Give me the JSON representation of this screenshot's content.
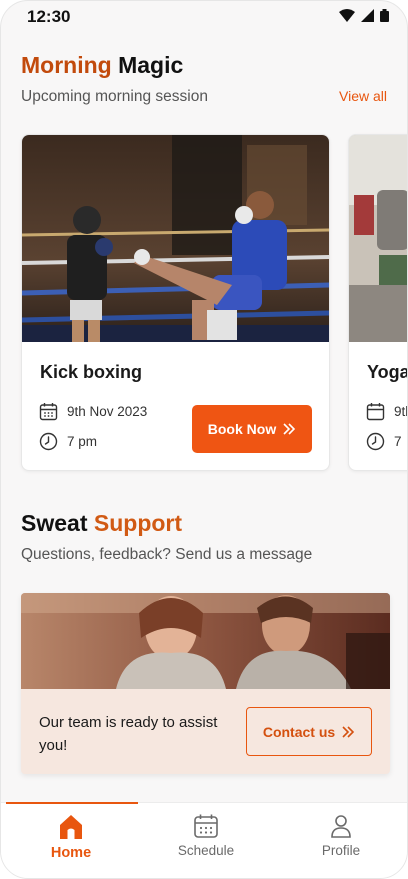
{
  "status_bar": {
    "time": "12:30"
  },
  "morning": {
    "title_accent": "Morning",
    "title_rest": "Magic",
    "subtitle": "Upcoming morning session",
    "view_all": "View all",
    "sessions": [
      {
        "name": "Kick boxing",
        "date": "9th Nov 2023",
        "time": "7 pm",
        "book_label": "Book Now"
      },
      {
        "name": "Yoga",
        "date": "9th",
        "time": "7"
      }
    ]
  },
  "support": {
    "title_rest": "Sweat",
    "title_accent": "Support",
    "subtitle": "Questions, feedback? Send us a message",
    "message": "Our team is ready to assist you!",
    "contact_label": "Contact us"
  },
  "nav": {
    "items": [
      {
        "label": "Home",
        "icon": "home-icon",
        "active": true
      },
      {
        "label": "Schedule",
        "icon": "calendar-icon",
        "active": false
      },
      {
        "label": "Profile",
        "icon": "profile-icon",
        "active": false
      }
    ]
  },
  "colors": {
    "accent": "#e8560f",
    "accent_dark": "#c24a0c",
    "support_bg": "#f6e7df"
  }
}
